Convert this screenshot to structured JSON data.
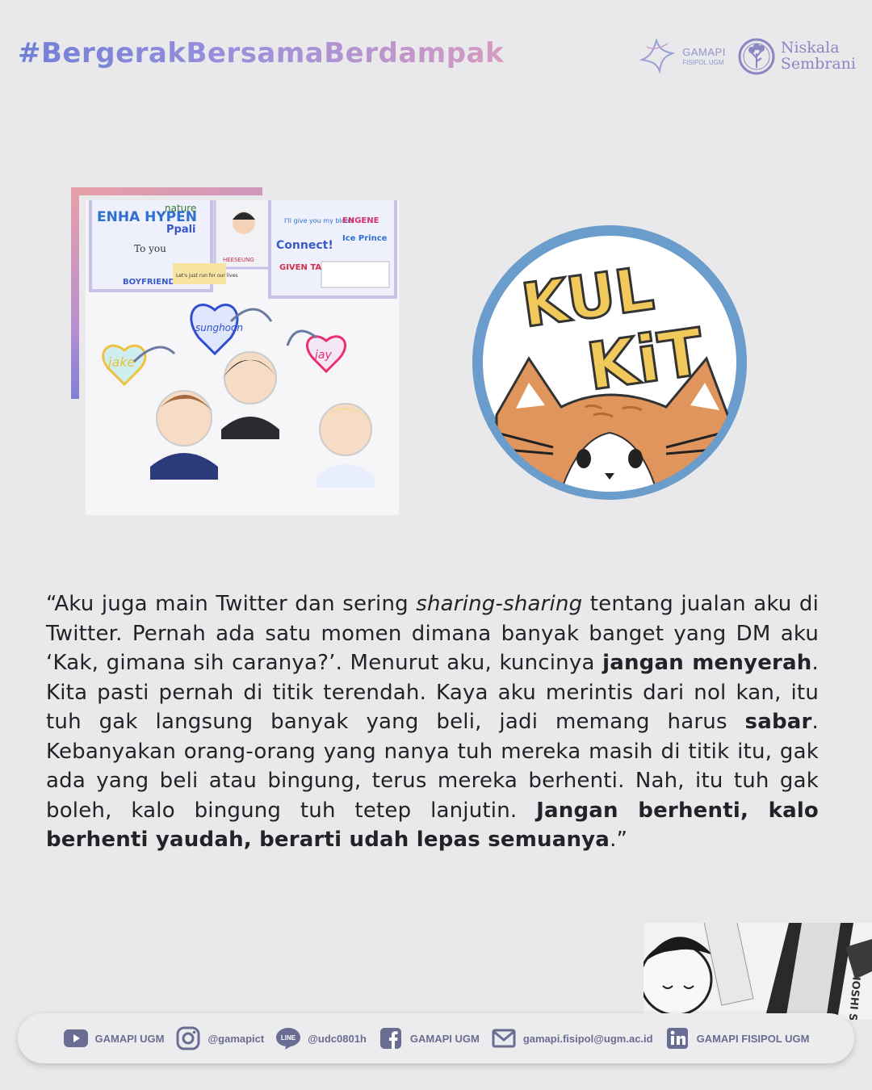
{
  "header": {
    "hashtag": "#BergerakBersamaBerdampak",
    "gamapi_name": "GAMAPI",
    "gamapi_sub": "FISIPOL UGM",
    "niskala_line1": "Niskala",
    "niskala_line2": "Sembrani"
  },
  "badge": {
    "line1": "KUL",
    "line2": "KiT",
    "colors": {
      "ring": "#6a9ccc",
      "cat": "#e0955c",
      "letters": "#f0c95a"
    }
  },
  "photo": {
    "stickers": [
      "ENHA HYPEN",
      "nature",
      "Ppali",
      "To you",
      "BOYFRIEND",
      "Let's just run for our lives",
      "I'll give you my blood",
      "Connect!",
      "Ice Prince",
      "GIVEN TAKEN",
      "ENGENE",
      "HEESEUNG"
    ],
    "keychains": [
      "jake",
      "sunghoon",
      "jay"
    ]
  },
  "quote": {
    "p1": "“Aku juga main Twitter dan sering ",
    "p2": "sharing-sharing",
    "p3": " tentang jualan aku di Twitter. Pernah ada satu momen dimana banyak banget yang DM aku ‘Kak, gimana sih caranya?’. Menurut aku, kuncinya ",
    "p4": "jangan menyerah",
    "p5": ". Kita pasti pernah di titik terendah. Kaya aku merintis dari nol kan, itu tuh gak langsung banyak yang beli, jadi memang harus ",
    "p6": "sabar",
    "p7": ". Kebanyakan orang-orang yang nanya tuh mereka masih di titik itu, gak ada yang beli atau bingung, terus mereka berhenti. Nah, itu tuh gak boleh, kalo bingung tuh tetep lanjutin. ",
    "p8": "Jangan berhenti, kalo berhenti yaudah, berarti udah lepas semuanya",
    "p9": ".”"
  },
  "bw_photo": {
    "lanyard_text": "HOSHI SEVENTEEN"
  },
  "footer": {
    "items": [
      {
        "icon": "youtube-icon",
        "label": "GAMAPI UGM"
      },
      {
        "icon": "instagram-icon",
        "label": "@gamapict"
      },
      {
        "icon": "line-icon",
        "label": "@udc0801h",
        "icon_text": "LINE"
      },
      {
        "icon": "facebook-icon",
        "label": "GAMAPI UGM"
      },
      {
        "icon": "mail-icon",
        "label": "gamapi.fisipol@ugm.ac.id"
      },
      {
        "icon": "linkedin-icon",
        "label": "GAMAPI FISIPOL UGM"
      }
    ],
    "icon_color": "#6a6d92"
  }
}
